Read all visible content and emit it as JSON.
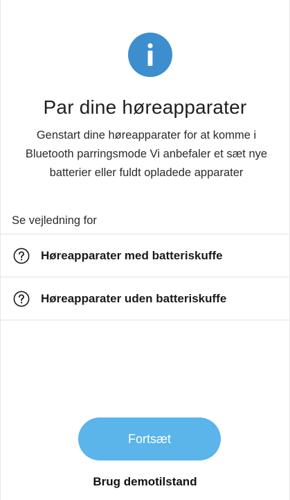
{
  "header": {
    "icon": "info-icon",
    "title": "Par dine høreapparater",
    "description": "Genstart dine høreapparater for at komme i Bluetooth parringsmode Vi anbefaler et sæt nye batterier eller fuldt opladede apparater"
  },
  "guides": {
    "section_label": "Se vejledning for",
    "items": [
      {
        "icon": "question-circle-icon",
        "label": "Høreapparater med batteriskuffe"
      },
      {
        "icon": "question-circle-icon",
        "label": "Høreapparater uden batteriskuffe"
      }
    ]
  },
  "actions": {
    "continue_label": "Fortsæt",
    "demo_label": "Brug demotilstand"
  },
  "colors": {
    "info_icon_bg": "#3d8ecf",
    "primary_button_bg": "#5bb4ea",
    "divider": "#e3e3e3"
  }
}
